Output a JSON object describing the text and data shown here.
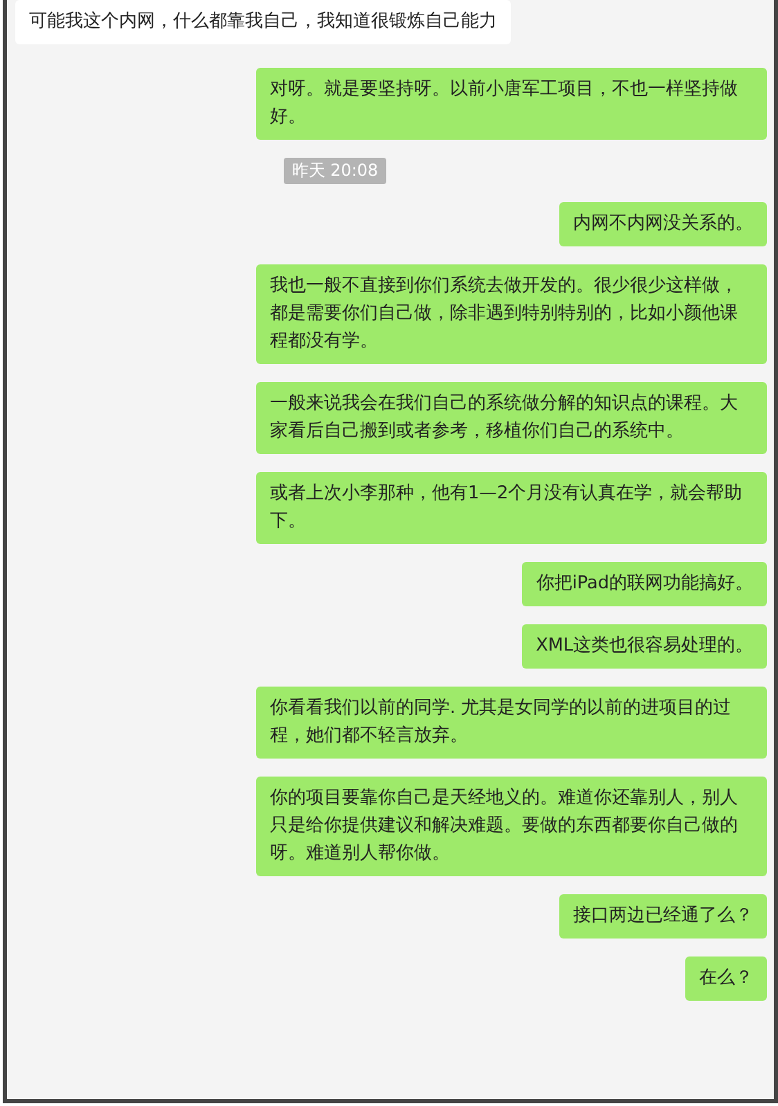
{
  "messages": [
    {
      "kind": "text",
      "outgoing": false,
      "text": "可能我这个内网，什么都靠我自己，我知道很锻炼自己能力"
    },
    {
      "kind": "text",
      "outgoing": true,
      "text": "对呀。就是要坚持呀。以前小唐军工项目，不也一样坚持做好。"
    },
    {
      "kind": "time",
      "text": "昨天 20:08"
    },
    {
      "kind": "text",
      "outgoing": true,
      "text": "内网不内网没关系的。"
    },
    {
      "kind": "text",
      "outgoing": true,
      "text": "我也一般不直接到你们系统去做开发的。很少很少这样做，都是需要你们自己做，除非遇到特别特别的，比如小颜他课程都没有学。"
    },
    {
      "kind": "text",
      "outgoing": true,
      "text": "一般来说我会在我们自己的系统做分解的知识点的课程。大家看后自己搬到或者参考，移植你们自己的系统中。"
    },
    {
      "kind": "text",
      "outgoing": true,
      "text": "或者上次小李那种，他有1—2个月没有认真在学，就会帮助下。"
    },
    {
      "kind": "text",
      "outgoing": true,
      "text": "你把iPad的联网功能搞好。"
    },
    {
      "kind": "text",
      "outgoing": true,
      "text": "XML这类也很容易处理的。"
    },
    {
      "kind": "text",
      "outgoing": true,
      "text": "你看看我们以前的同学. 尤其是女同学的以前的进项目的过程，她们都不轻言放弃。"
    },
    {
      "kind": "text",
      "outgoing": true,
      "text": "你的项目要靠你自己是天经地义的。难道你还靠别人，别人只是给你提供建议和解决难题。要做的东西都要你自己做的呀。难道别人帮你做。"
    },
    {
      "kind": "text",
      "outgoing": true,
      "text": "接口两边已经通了么？"
    },
    {
      "kind": "text",
      "outgoing": true,
      "text": "在么？"
    }
  ]
}
